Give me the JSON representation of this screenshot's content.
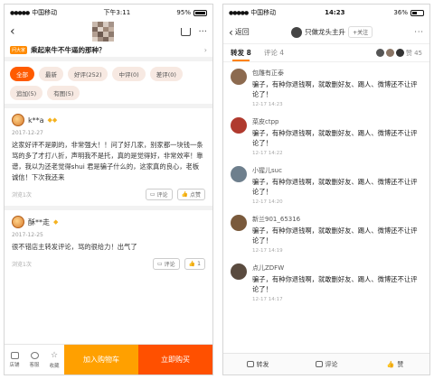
{
  "left": {
    "status": {
      "carrier": "中国移动",
      "time": "下午3:11",
      "battery": "95%"
    },
    "title_tag": "问大家",
    "question": "乘起来牛不牛逼的那种？",
    "filters": [
      {
        "label": "全部",
        "active": true
      },
      {
        "label": "最新",
        "active": false
      },
      {
        "label": "好评(252)",
        "active": false
      },
      {
        "label": "中评(0)",
        "active": false
      },
      {
        "label": "差评(0)",
        "active": false
      },
      {
        "label": "追加(5)",
        "active": false
      },
      {
        "label": "有图(5)",
        "active": false
      }
    ],
    "reviews": [
      {
        "name": "k**a",
        "date": "2017-12-27",
        "text": "这家好评不是刷的，非常强大！！问了好几家，别家都一块钱一条骂的多了才打八折，声明我不是托，真的是觉得好，非常效率！靠谱，我以为还老觉得shui 君是骗子什么的，这家真的良心，老板诚信！下次我还来",
        "views": "浏览1次",
        "comment_label": "评论",
        "like_label": "点赞"
      },
      {
        "name": "酥**走",
        "date": "2017-12-25",
        "text": "很不错店主转发评论，骂的很给力！出气了",
        "views": "浏览1次",
        "comment_label": "评论",
        "like_label": "1"
      }
    ],
    "bottom": {
      "shop": "店铺",
      "service": "客服",
      "fav": "收藏",
      "add_cart": "加入购物车",
      "buy": "立即购买"
    }
  },
  "right": {
    "status": {
      "carrier": "中国移动",
      "time": "14:23",
      "battery": "36%"
    },
    "back_label": "返回",
    "account_name": "只做龙头主升",
    "follow_label": "+关注",
    "tabs": {
      "repost": "转发 8",
      "comment": "评论 4",
      "like": "赞 45"
    },
    "reposts": [
      {
        "name": "包雕有正泰",
        "text": "骗子，有种你退钱啊，就敢删好友、踢人、微博还不让评论了！",
        "time": "12-17 14:23",
        "color": "#8c6a4f"
      },
      {
        "name": "菜皮ctpp",
        "text": "骗子，有种你退钱啊，就敢删好友、踢人、微博还不让评论了！",
        "time": "12-17 14:22",
        "color": "#b03a2e"
      },
      {
        "name": "小猩儿suc",
        "text": "骗子，有种你退钱啊，就敢删好友、踢人、微博还不让评论了！",
        "time": "12-17 14:20",
        "color": "#6e7f8d"
      },
      {
        "name": "新兰901_65316",
        "text": "骗子，有种你退钱啊，就敢删好友、踢人、微博还不让评论了！",
        "time": "12-17 14:19",
        "color": "#7a5a3c"
      },
      {
        "name": "点儿ZDFW",
        "text": "骗子，有种你退钱啊，就敢删好友、踢人、微博还不让评论了！",
        "time": "12-17 14:17",
        "color": "#5a4b3f"
      }
    ],
    "footer": {
      "repost": "转发",
      "comment": "评论",
      "like": "赞"
    }
  }
}
